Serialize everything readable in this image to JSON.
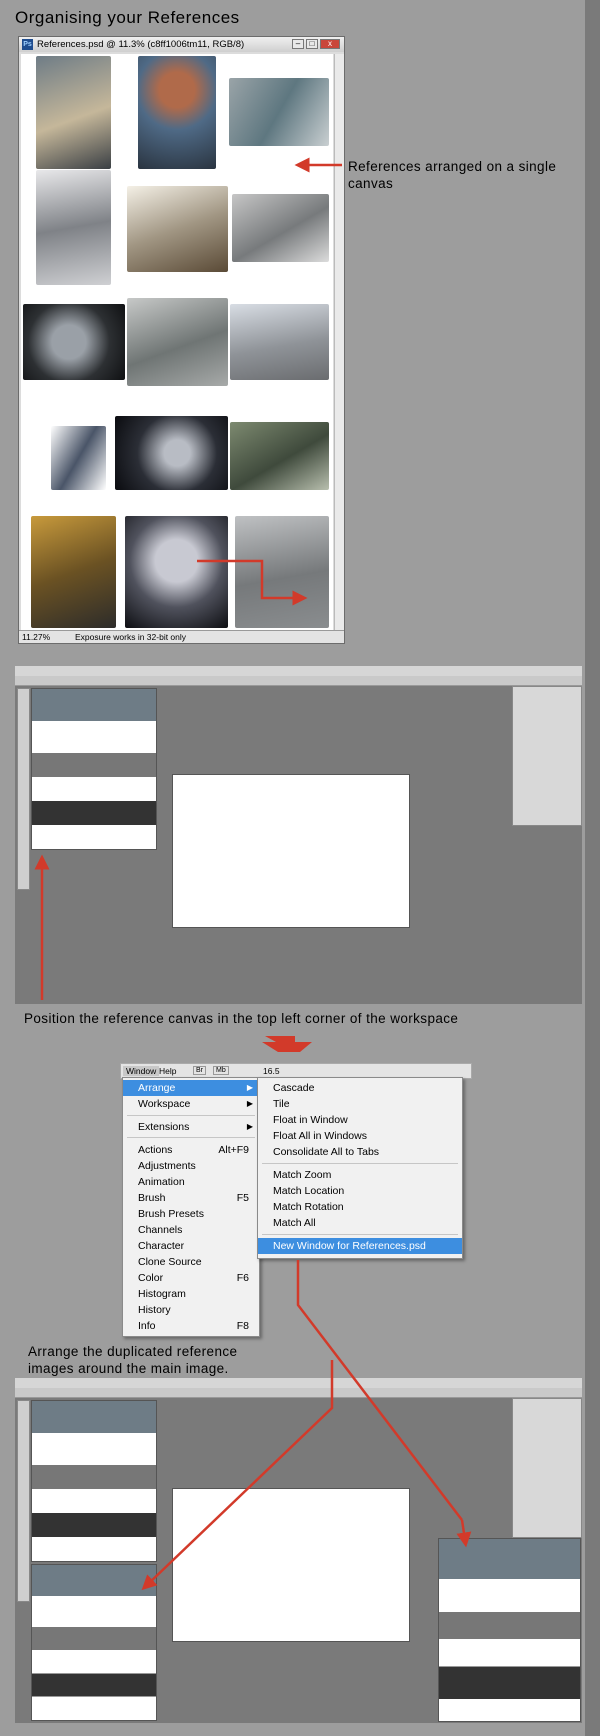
{
  "heading": "Organising your References",
  "window": {
    "title": "References.psd @ 11.3% (c8ff1006tm11, RGB/8)",
    "ps_badge": "Ps",
    "btn_min": "–",
    "btn_max": "□",
    "btn_close": "x",
    "zoom": "11.27%",
    "status_text": "Exposure works in 32-bit only"
  },
  "callouts": {
    "single_canvas": "References arranged on a single canvas",
    "position_canvas": "Position the reference canvas in the top left corner of the workspace",
    "arrange_dup": "Arrange the duplicated reference images around the main image."
  },
  "menubar": {
    "window": "Window",
    "help": "Help",
    "br": "Br",
    "mb": "Mb",
    "zoom": "16.5"
  },
  "window_menu": {
    "items": [
      {
        "label": "Arrange",
        "submenu": true,
        "selected": true
      },
      {
        "label": "Workspace",
        "submenu": true
      },
      {
        "label": "Extensions",
        "submenu": true
      },
      {
        "label": "Actions",
        "shortcut": "Alt+F9"
      },
      {
        "label": "Adjustments"
      },
      {
        "label": "Animation"
      },
      {
        "label": "Brush",
        "shortcut": "F5"
      },
      {
        "label": "Brush Presets"
      },
      {
        "label": "Channels"
      },
      {
        "label": "Character"
      },
      {
        "label": "Clone Source"
      },
      {
        "label": "Color",
        "shortcut": "F6"
      },
      {
        "label": "Histogram"
      },
      {
        "label": "History"
      },
      {
        "label": "Info",
        "shortcut": "F8"
      }
    ]
  },
  "arrange_submenu": {
    "items": [
      {
        "label": "Cascade"
      },
      {
        "label": "Tile"
      },
      {
        "label": "Float in Window"
      },
      {
        "label": "Float All in Windows"
      },
      {
        "label": "Consolidate All to Tabs"
      },
      {
        "label": "Match Zoom"
      },
      {
        "label": "Match Location"
      },
      {
        "label": "Match Rotation"
      },
      {
        "label": "Match All"
      },
      {
        "label": "New Window for References.psd",
        "selected": true
      }
    ]
  },
  "colors": {
    "page_bg": "#9d9d9d",
    "workspace_bg": "#7a7a7a",
    "arrow_red": "#d23a2a",
    "menu_highlight": "#3d8ee0"
  }
}
